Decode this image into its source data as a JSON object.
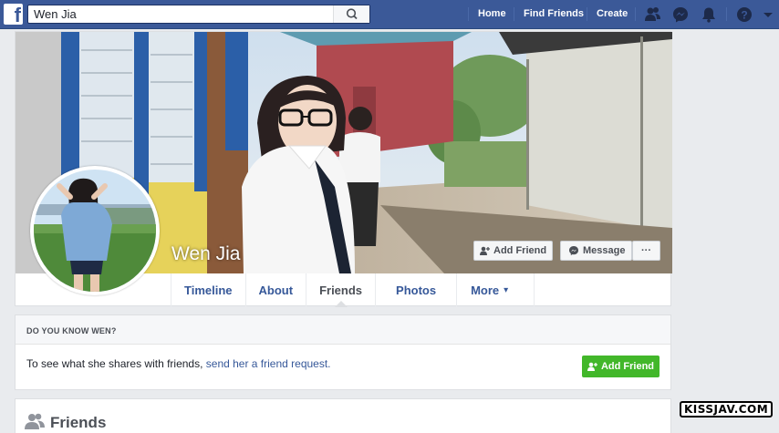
{
  "topbar": {
    "logo": "f",
    "search_value": "Wen Jia",
    "search_icon": "search-icon",
    "nav": [
      "Home",
      "Find Friends",
      "Create"
    ],
    "icons": [
      "friend-requests-icon",
      "messenger-icon",
      "notifications-icon",
      "help-icon",
      "account-menu-icon"
    ]
  },
  "profile": {
    "name": "Wen Jia",
    "add_friend": "Add Friend",
    "message": "Message",
    "more_dots": "···"
  },
  "tabs": [
    "Timeline",
    "About",
    "Friends",
    "Photos",
    "More"
  ],
  "more_caret": "▾",
  "know": {
    "header": "DO YOU KNOW WEN?",
    "text_before": "To see what she shares with friends, ",
    "link": "send her a friend request.",
    "button": "Add Friend"
  },
  "friends": {
    "title": "Friends"
  },
  "watermark": "KISSJAV.COM",
  "colors": {
    "brand": "#3b5998",
    "link": "#365899",
    "green": "#42b72a"
  }
}
